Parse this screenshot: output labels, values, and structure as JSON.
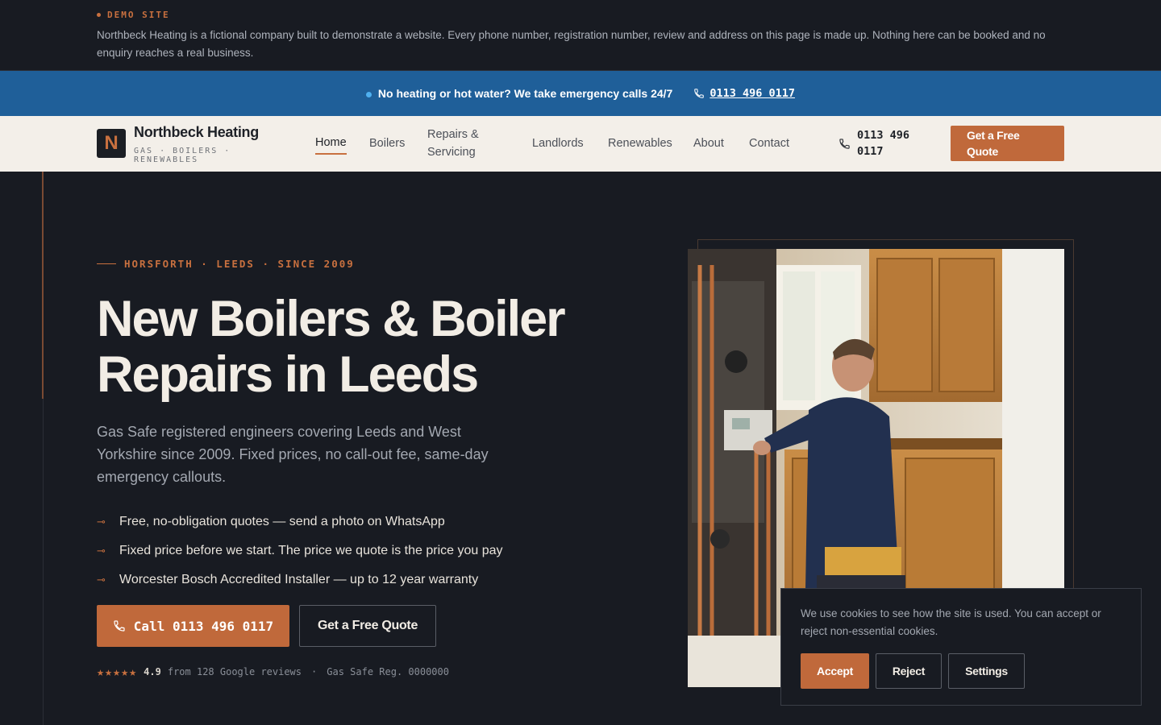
{
  "demo": {
    "tag": "DEMO SITE",
    "text": "Northbeck Heating is a fictional company built to demonstrate a website. Every phone number, registration number, review and address on this page is made up. Nothing here can be booked and no enquiry reaches a real business."
  },
  "emergency": {
    "message": "No heating or hot water? We take emergency calls 24/7",
    "phone": "0113 496 0117"
  },
  "header": {
    "logo_letter": "N",
    "brand": "Northbeck Heating",
    "tagline": "GAS · BOILERS · RENEWABLES",
    "nav": {
      "home": "Home",
      "boilers": "Boilers",
      "repairs": "Repairs & Servicing",
      "landlords": "Landlords",
      "renewables": "Renewables",
      "about": "About",
      "contact": "Contact"
    },
    "phone": "0113 496 0117",
    "quote_button": "Get a Free Quote"
  },
  "hero": {
    "eyebrow": "HORSFORTH · LEEDS · SINCE 2009",
    "title": "New Boilers & Boiler Repairs in Leeds",
    "lead": "Gas Safe registered engineers covering Leeds and West Yorkshire since 2009. Fixed prices, no call-out fee, same-day emergency callouts.",
    "bullets": [
      "Free, no-obligation quotes — send a photo on WhatsApp",
      "Fixed price before we start. The price we quote is the price you pay",
      "Worcester Bosch Accredited Installer — up to 12 year warranty"
    ],
    "call_button": "Call 0113 496 0117",
    "quote_button": "Get a Free Quote",
    "rating": {
      "stars": "★★★★★",
      "score": "4.9",
      "reviews": "from 128 Google reviews",
      "separator": "·",
      "gas_safe": "Gas Safe Reg. 0000000"
    }
  },
  "cookie": {
    "text": "We use cookies to see how the site is used. You can accept or reject non-essential cookies.",
    "accept": "Accept",
    "reject": "Reject",
    "settings": "Settings"
  },
  "colors": {
    "accent": "#c0693b",
    "background": "#181b22",
    "emergency_bar": "#1f5f99",
    "header_bg": "#f3efe9"
  }
}
